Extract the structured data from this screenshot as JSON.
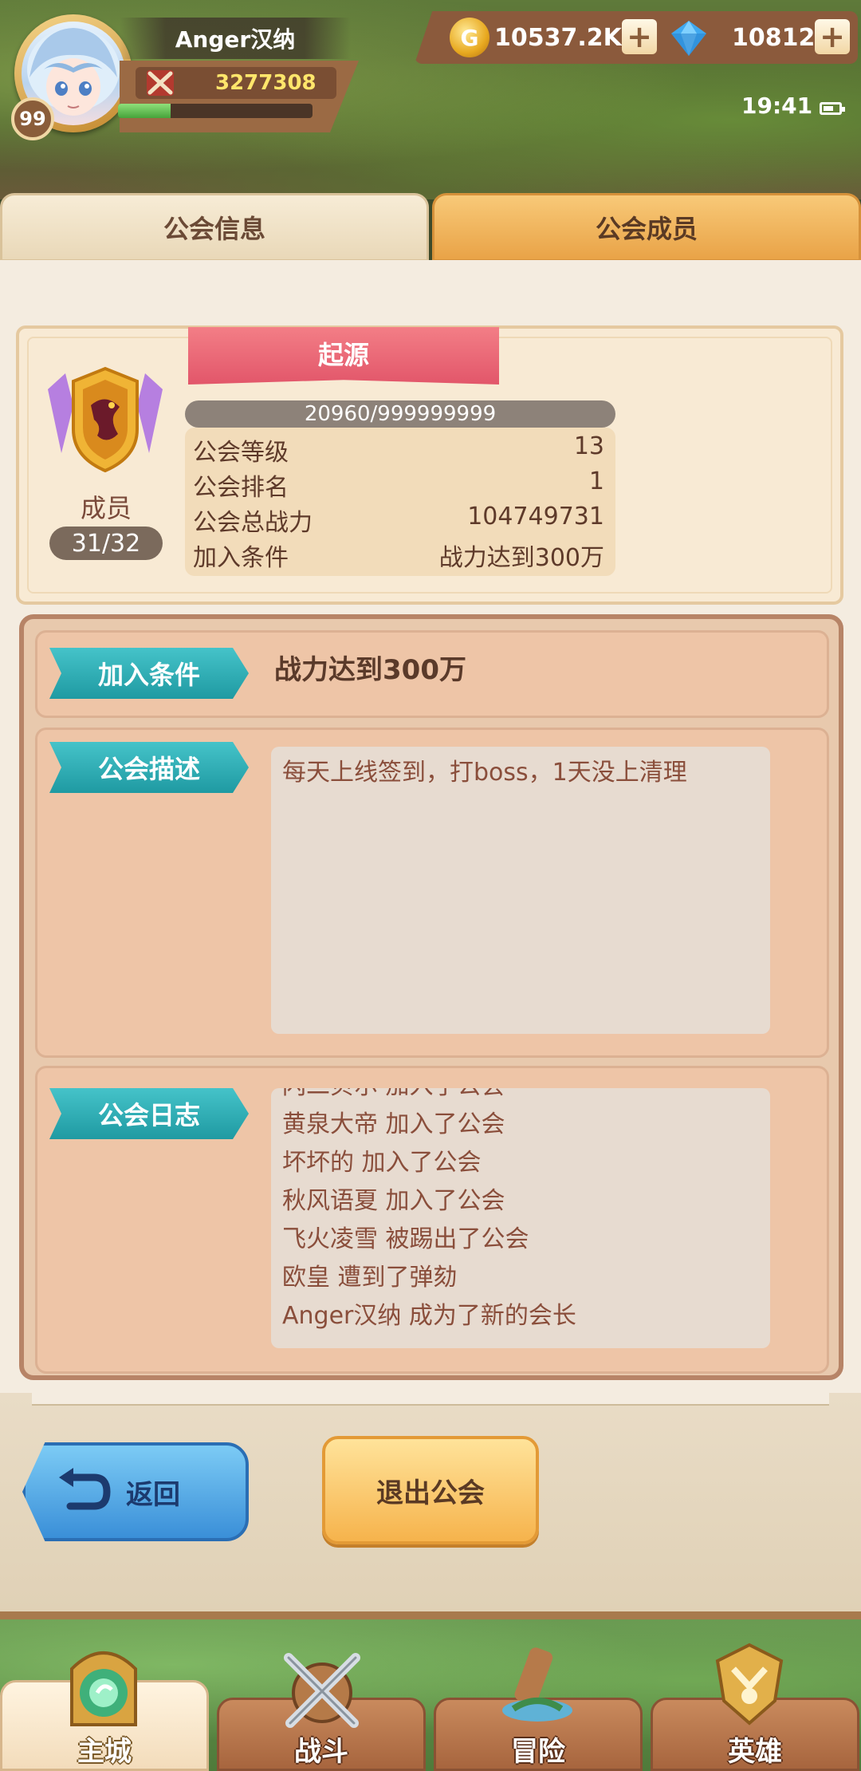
{
  "header": {
    "player_name": "Anger汉纳",
    "level": "99",
    "power": "3277308",
    "exp_fraction": 0.27,
    "gold": "10537.2K",
    "gems": "10812",
    "plus_label": "+",
    "gold_symbol": "G",
    "time": "19:41"
  },
  "tabs": {
    "info": "公会信息",
    "members": "公会成员"
  },
  "guild": {
    "name": "起源",
    "members_label": "成员",
    "members_count": "31/32",
    "exp": "20960/999999999",
    "stats": [
      {
        "label": "公会等级",
        "value": "13"
      },
      {
        "label": "公会排名",
        "value": "1"
      },
      {
        "label": "公会总战力",
        "value": "104749731"
      },
      {
        "label": "加入条件",
        "value": "战力达到300万"
      }
    ]
  },
  "sections": {
    "join_tag": "加入条件",
    "join_value": "战力达到300万",
    "desc_tag": "公会描述",
    "desc_text": "每天上线签到，打boss，1天没上清理",
    "log_tag": "公会日志",
    "log": [
      "闪二贝尔 加入了公会",
      "黄泉大帝 加入了公会",
      "坏坏的 加入了公会",
      "秋风语夏 加入了公会",
      "飞火凌雪 被踢出了公会",
      "欧皇 遭到了弹劾",
      "Anger汉纳 成为了新的会长"
    ]
  },
  "buttons": {
    "back": "返回",
    "quit": "退出公会"
  },
  "nav": {
    "city": "主城",
    "battle": "战斗",
    "adventure": "冒险",
    "heroes": "英雄"
  },
  "colors": {
    "tag_teal": "#1f9aa2",
    "ribbon_pink": "#e2566a",
    "gold_accent": "#f6b34c"
  }
}
